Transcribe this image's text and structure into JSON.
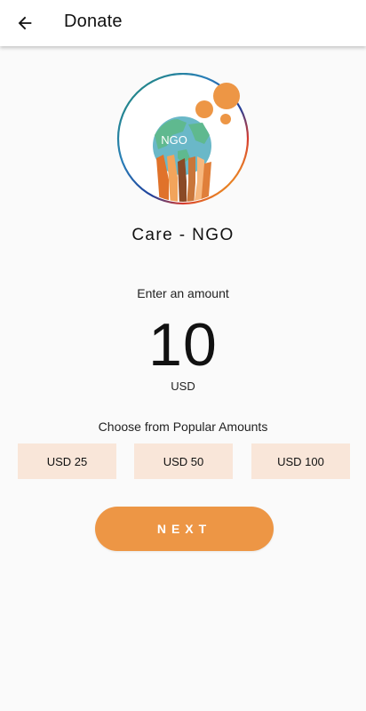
{
  "header": {
    "title": "Donate"
  },
  "organization": {
    "name": "Care - NGO",
    "logo_text": "NGO"
  },
  "amount_entry": {
    "label": "Enter an amount",
    "value": "10",
    "currency": "USD"
  },
  "popular": {
    "label": "Choose from Popular Amounts",
    "options": [
      "USD 25",
      "USD 50",
      "USD 100"
    ]
  },
  "actions": {
    "next_label": "NEXT"
  },
  "colors": {
    "accent": "#ed9645",
    "preset_bg": "#f9e6d9",
    "globe": "#6ab8c8",
    "land": "#5fb98f"
  }
}
